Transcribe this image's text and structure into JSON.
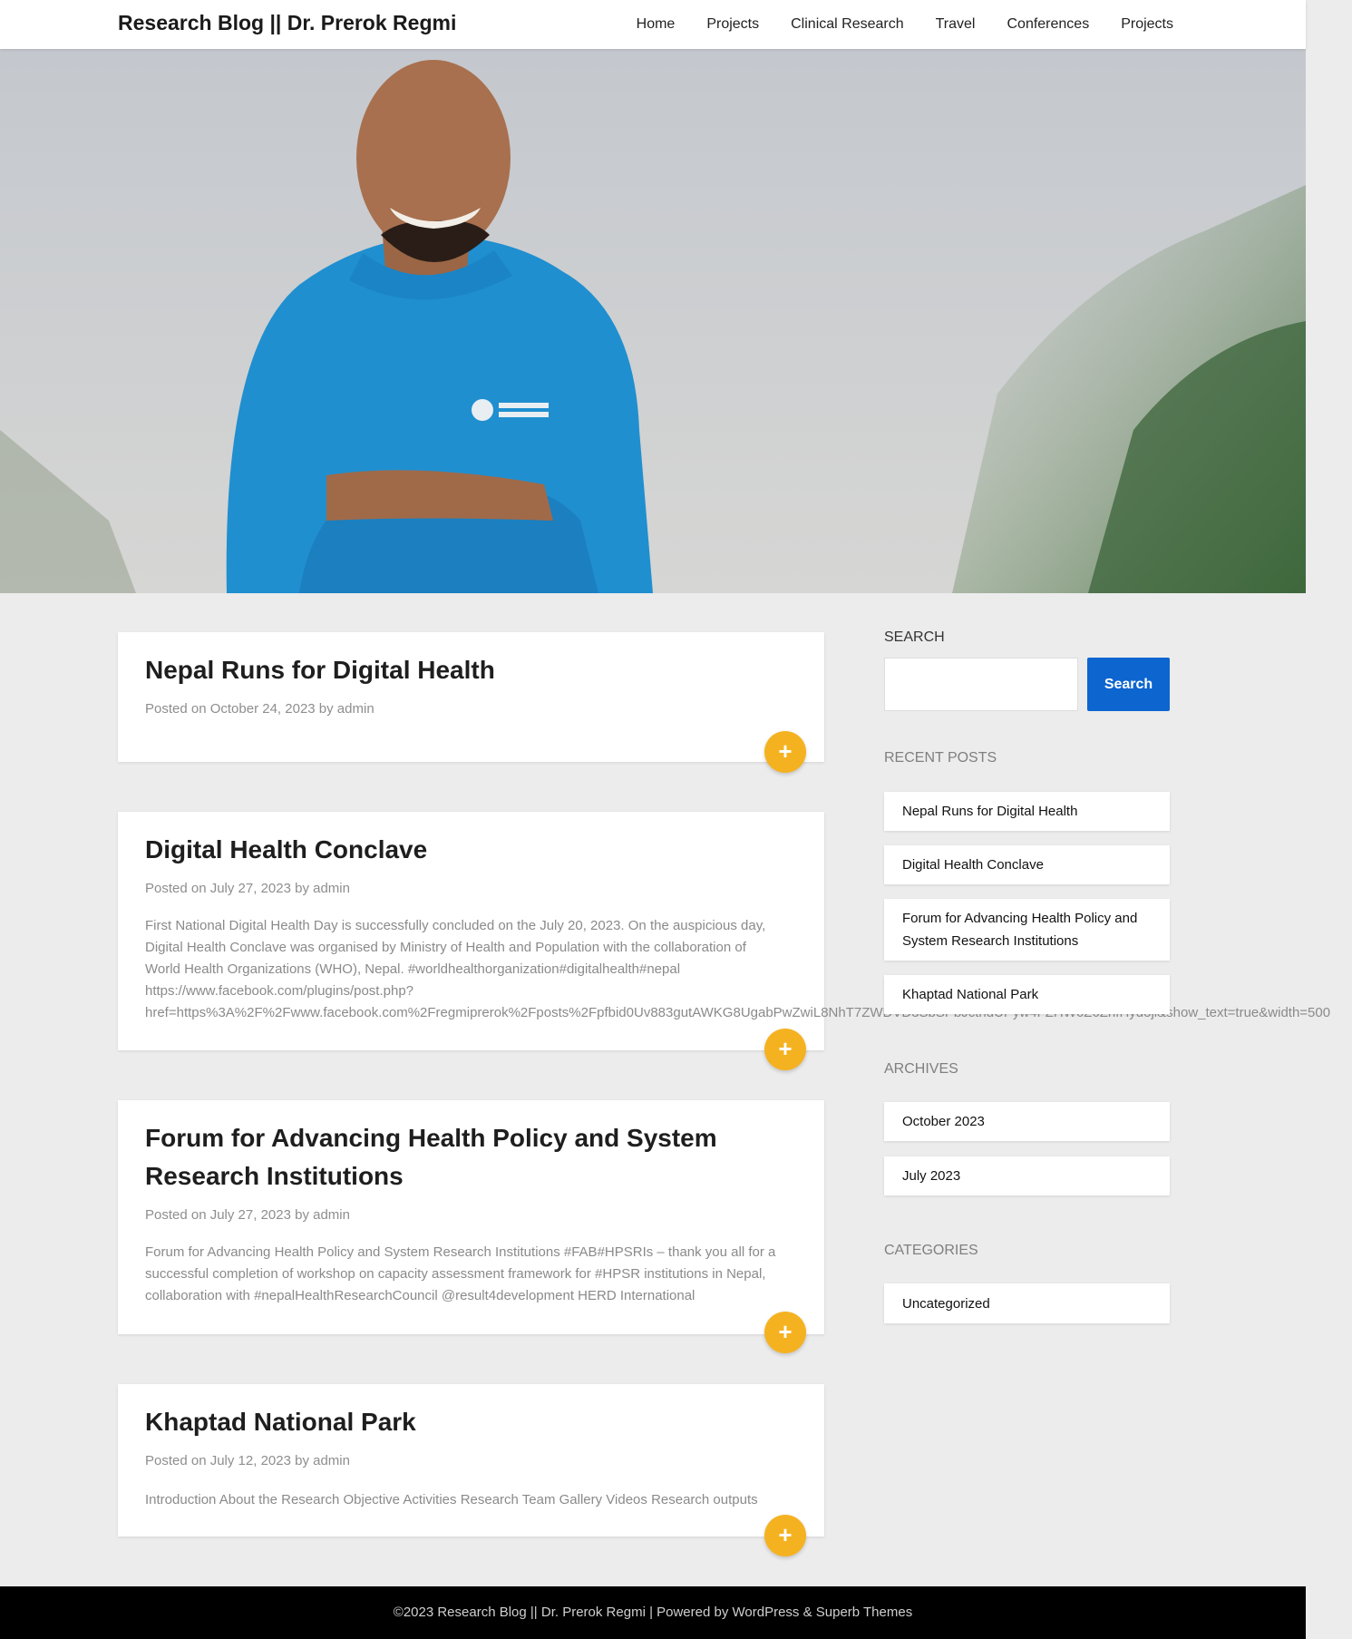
{
  "header": {
    "site_title": "Research Blog || Dr. Prerok Regmi",
    "nav": [
      "Home",
      "Projects",
      "Clinical Research",
      "Travel",
      "Conferences",
      "Projects"
    ]
  },
  "posts": [
    {
      "title": "Nepal Runs for Digital Health",
      "meta": "Posted on October 24, 2023 by admin",
      "excerpt_lines": []
    },
    {
      "title": "Digital Health Conclave",
      "meta": "Posted on July 27, 2023 by admin",
      "excerpt_lines": [
        "First National Digital Health Day is successfully concluded on the July 20, 2023. On the auspicious day,",
        "Digital Health Conclave was organised by Ministry of Health and Population with the collaboration of",
        "World Health Organizations (WHO), Nepal. #worldhealthorganization#digitalhealth#nepal",
        "https://www.facebook.com/plugins/post.php?",
        "href=https%3A%2F%2Fwww.facebook.com%2Fregmiprerok%2Fposts%2Fpfbid0Uv883gutAWKG8UgabPwZwiL8NhT7ZWDVD3SbSPbJcthdUPyw4FZHW6Z6ZhfHydojl&show_text=true&width=500"
      ]
    },
    {
      "title": "Forum for Advancing Health Policy and System Research Institutions",
      "meta": "Posted on July 27, 2023 by admin",
      "excerpt_lines": [
        "Forum for Advancing Health Policy and System Research Institutions #FAB#HPSRIs – thank you all for a",
        "successful completion of workshop on capacity assessment framework for #HPSR institutions in Nepal,",
        "collaboration with #nepalHealthResearchCouncil @result4development HERD International"
      ]
    },
    {
      "title": "Khaptad National Park",
      "meta": "Posted on July 12, 2023 by admin",
      "excerpt_lines": [
        "Introduction About the Research Objective Activities Research Team Gallery Videos Research outputs"
      ]
    }
  ],
  "plus_label": "+",
  "sidebar": {
    "search_heading": "SEARCH",
    "search_button": "Search",
    "recent_heading": "RECENT POSTS",
    "recent_posts": [
      "Nepal Runs for Digital Health",
      "Digital Health Conclave",
      "Forum for Advancing Health Policy and System Research Institutions",
      "Khaptad National Park"
    ],
    "archives_heading": "ARCHIVES",
    "archives": [
      "October 2023",
      "July 2023"
    ],
    "categories_heading": "CATEGORIES",
    "categories": [
      "Uncategorized"
    ]
  },
  "footer": {
    "text": "©2023 Research Blog || Dr. Prerok Regmi | Powered by WordPress & Superb Themes"
  },
  "colors": {
    "accent_button": "#f5b220",
    "search_button": "#0d65cf",
    "footer_bg": "#000000"
  }
}
